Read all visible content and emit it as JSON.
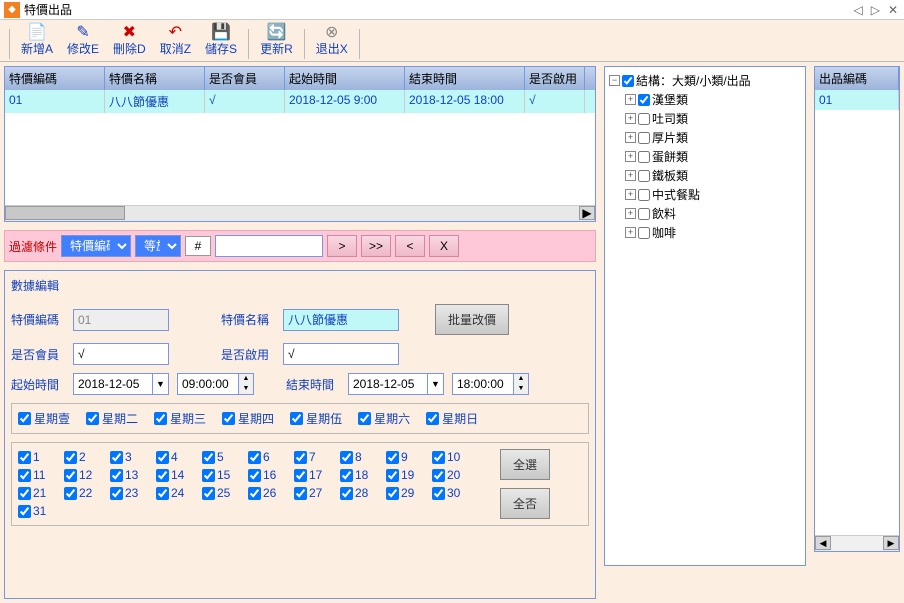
{
  "window": {
    "title": "特價出品"
  },
  "winbtns": {
    "prev": "◁",
    "next": "▷",
    "close": "✕"
  },
  "toolbar": [
    {
      "id": "new",
      "label": "新增A",
      "icon": "📄"
    },
    {
      "id": "edit",
      "label": "修改E",
      "icon": "✎"
    },
    {
      "id": "del",
      "label": "刪除D",
      "icon": "✖"
    },
    {
      "id": "cancel",
      "label": "取消Z",
      "icon": "↶"
    },
    {
      "id": "save",
      "label": "儲存S",
      "icon": "💾"
    },
    {
      "id": "refresh",
      "label": "更新R",
      "icon": "🔄"
    },
    {
      "id": "exit",
      "label": "退出X",
      "icon": "⊗"
    }
  ],
  "grid": {
    "headers": [
      "特價編碼",
      "特價名稱",
      "是否會員",
      "起始時間",
      "結束時間",
      "是否啟用"
    ],
    "widths": [
      100,
      100,
      80,
      120,
      120,
      60
    ],
    "rows": [
      {
        "code": "01",
        "name": "八八節優惠",
        "member": "√",
        "start": "2018-12-05 9:00",
        "end": "2018-12-05 18:00",
        "enabled": "√"
      }
    ]
  },
  "filter": {
    "label": "過濾條件",
    "field": "特價編碼",
    "op": "等於",
    "hash": "#",
    "value": "",
    "btns": {
      "next": ">",
      "fast": ">>",
      "prev": "<",
      "clear": "X"
    }
  },
  "edit": {
    "title": "數據編輯",
    "code_label": "特價編碼",
    "code": "01",
    "name_label": "特價名稱",
    "name": "八八節優惠",
    "batch": "批量改價",
    "member_label": "是否會員",
    "member": "√",
    "enabled_label": "是否啟用",
    "enabled": "√",
    "start_label": "起始時間",
    "start_date": "2018-12-05",
    "start_time": "09:00:00",
    "end_label": "結束時間",
    "end_date": "2018-12-05",
    "end_time": "18:00:00",
    "weekdays": [
      "星期壹",
      "星期二",
      "星期三",
      "星期四",
      "星期伍",
      "星期六",
      "星期日"
    ],
    "days": [
      "1",
      "2",
      "3",
      "4",
      "5",
      "6",
      "7",
      "8",
      "9",
      "10",
      "11",
      "12",
      "13",
      "14",
      "15",
      "16",
      "17",
      "18",
      "19",
      "20",
      "21",
      "22",
      "23",
      "24",
      "25",
      "26",
      "27",
      "28",
      "29",
      "30",
      "31"
    ],
    "all": "全選",
    "none": "全否"
  },
  "tree": {
    "root": "結構：大類/小類/出品",
    "items": [
      {
        "label": "漢堡類",
        "checked": true
      },
      {
        "label": "吐司類",
        "checked": false
      },
      {
        "label": "厚片類",
        "checked": false
      },
      {
        "label": "蛋餅類",
        "checked": false
      },
      {
        "label": "鐵板類",
        "checked": false
      },
      {
        "label": "中式餐點",
        "checked": false
      },
      {
        "label": "飲料",
        "checked": false
      },
      {
        "label": "咖啡",
        "checked": false
      }
    ]
  },
  "rgrid": {
    "header": "出品編碼",
    "rows": [
      "01"
    ]
  }
}
